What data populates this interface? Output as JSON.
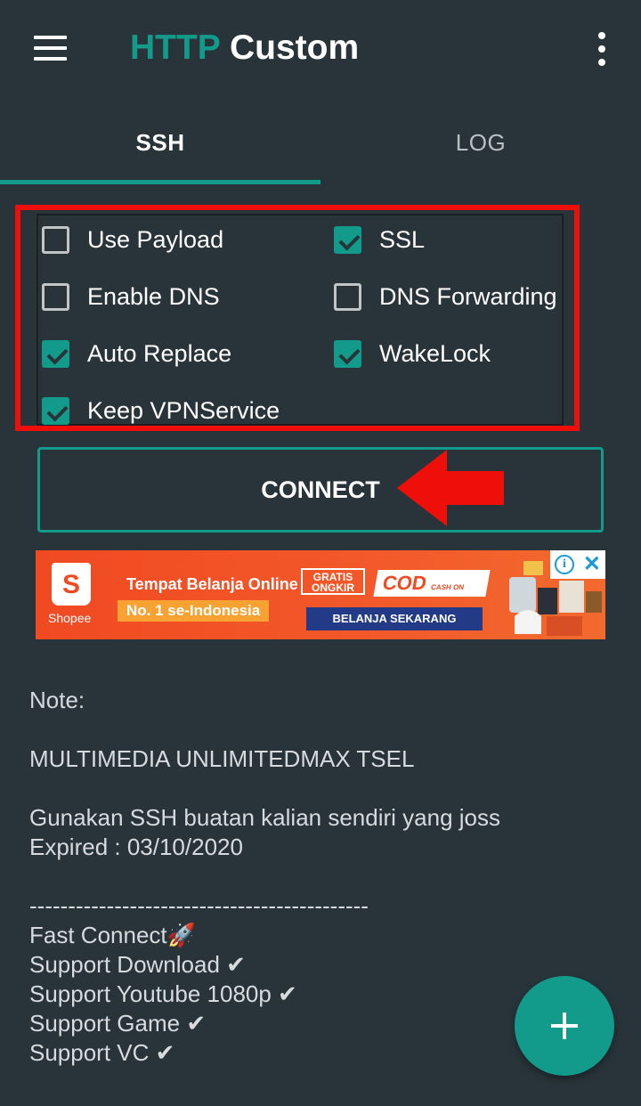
{
  "app": {
    "title_accent": "HTTP",
    "title_main": "Custom"
  },
  "tabs": [
    {
      "label": "SSH",
      "active": true
    },
    {
      "label": "LOG",
      "active": false
    }
  ],
  "options": [
    {
      "label": "Use Payload",
      "checked": false
    },
    {
      "label": "SSL",
      "checked": true
    },
    {
      "label": "Enable DNS",
      "checked": false
    },
    {
      "label": "DNS Forwarding",
      "checked": false
    },
    {
      "label": "Auto Replace",
      "checked": true
    },
    {
      "label": "WakeLock",
      "checked": true
    },
    {
      "label": "Keep VPNService",
      "checked": true
    }
  ],
  "connect_label": "CONNECT",
  "ad": {
    "brand": "Shopee",
    "logo_letter": "S",
    "line1": "Tempat Belanja Online",
    "line2": "No. 1 se-Indonesia",
    "gratis_1": "GRATIS",
    "gratis_2": "ONGKIR",
    "cod": "COD",
    "cod_small": "CASH ON DELIVERY",
    "cta": "BELANJA SEKARANG",
    "info_glyph": "i",
    "close_glyph": "✕"
  },
  "note": {
    "heading": "Note:",
    "line1": "MULTIMEDIA UNLIMITEDMAX TSEL",
    "line2": "Gunakan SSH buatan kalian sendiri yang joss",
    "line3": "Expired : 03/10/2020",
    "divider": "--------------------------------------------",
    "line4": "Fast Connect🚀",
    "line5": "Support Download ✔",
    "line6": "Support Youtube 1080p ✔",
    "line7": "Support Game ✔",
    "line8": "Support VC ✔"
  },
  "colors": {
    "accent": "#129b8a",
    "background": "#28343a",
    "highlight": "#ee0f0a"
  }
}
